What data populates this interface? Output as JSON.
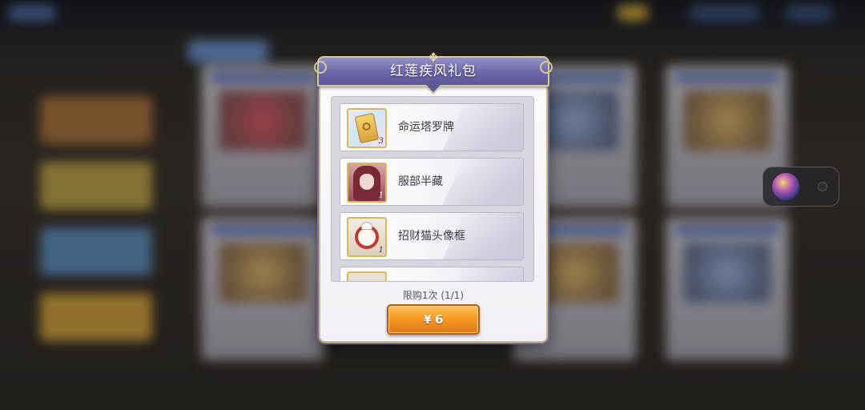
{
  "dialog": {
    "title": "红莲疾风礼包",
    "items": [
      {
        "name": "命运塔罗牌",
        "count": "3",
        "icon": "tarot-card-icon"
      },
      {
        "name": "服部半藏",
        "count": "1",
        "icon": "character-portrait-icon"
      },
      {
        "name": "招财猫头像框",
        "count": "1",
        "icon": "lucky-cat-frame-icon"
      },
      {
        "name": "",
        "count": "",
        "icon": "partial-item-icon"
      }
    ],
    "limit_text": "限购1次 (1/1)",
    "price": {
      "currency": "¥",
      "amount": "6"
    }
  },
  "colors": {
    "banner": "#6b67a8",
    "button": "#f59a23",
    "frame_gold": "#d7c69a"
  }
}
